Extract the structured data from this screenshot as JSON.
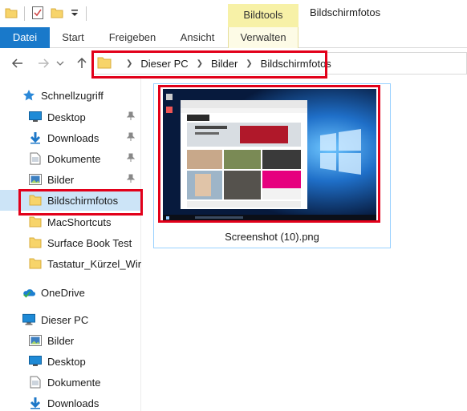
{
  "titlebar": {
    "contextual_tab": "Bildtools",
    "window_title": "Bildschirmfotos"
  },
  "ribbon": {
    "tabs": [
      {
        "label": "Datei"
      },
      {
        "label": "Start"
      },
      {
        "label": "Freigeben"
      },
      {
        "label": "Ansicht"
      },
      {
        "label": "Verwalten"
      }
    ]
  },
  "address": {
    "crumbs": [
      "Dieser PC",
      "Bilder",
      "Bildschirmfotos"
    ]
  },
  "navpane": {
    "quick_access": "Schnellzugriff",
    "quick_items": [
      {
        "label": "Desktop",
        "icon": "desktop-icon",
        "pinned": true
      },
      {
        "label": "Downloads",
        "icon": "download-icon",
        "pinned": true
      },
      {
        "label": "Dokumente",
        "icon": "documents-icon",
        "pinned": true
      },
      {
        "label": "Bilder",
        "icon": "pictures-icon",
        "pinned": true
      },
      {
        "label": "Bildschirmfotos",
        "icon": "folder-icon",
        "pinned": false
      },
      {
        "label": "MacShortcuts",
        "icon": "folder-icon",
        "pinned": false
      },
      {
        "label": "Surface Book Test",
        "icon": "folder-icon",
        "pinned": false
      },
      {
        "label": "Tastatur_Kürzel_Wir",
        "icon": "folder-icon",
        "pinned": false
      }
    ],
    "onedrive": "OneDrive",
    "this_pc": "Dieser PC",
    "pc_items": [
      {
        "label": "Bilder",
        "icon": "pictures-icon"
      },
      {
        "label": "Desktop",
        "icon": "desktop-icon"
      },
      {
        "label": "Dokumente",
        "icon": "documents-icon"
      },
      {
        "label": "Downloads",
        "icon": "download-icon"
      }
    ],
    "selected": "Bildschirmfotos"
  },
  "content": {
    "files": [
      {
        "name": "Screenshot (10).png"
      }
    ]
  },
  "colors": {
    "accent": "#1979ca",
    "highlight": "#e2001a",
    "contextual": "#f7f1a7",
    "folder": "#f7d46a"
  }
}
